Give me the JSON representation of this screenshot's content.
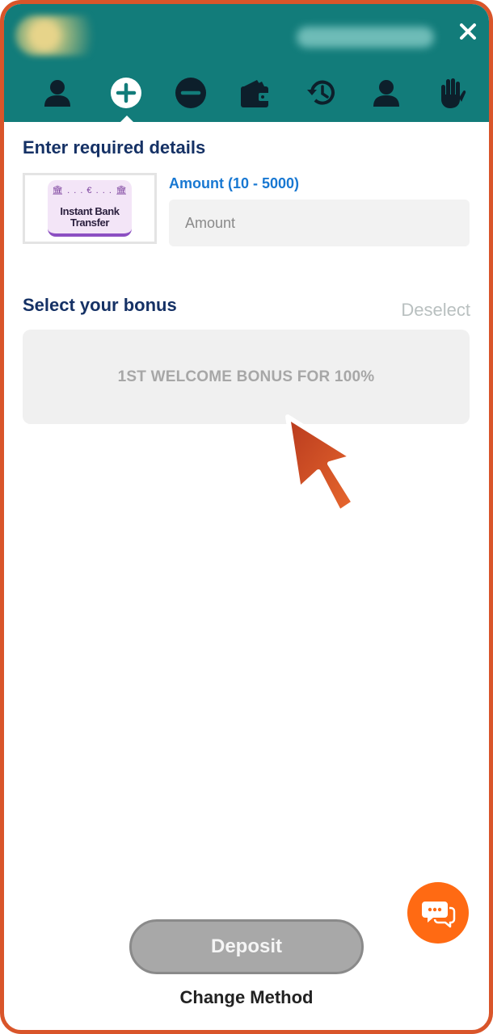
{
  "header": {
    "tabs": [
      {
        "icon": "user-icon",
        "active": false
      },
      {
        "icon": "plus-circle-icon",
        "active": true
      },
      {
        "icon": "minus-circle-icon",
        "active": false
      },
      {
        "icon": "wallet-icon",
        "active": false
      },
      {
        "icon": "history-icon",
        "active": false
      },
      {
        "icon": "profile-icon",
        "active": false
      },
      {
        "icon": "hand-icon",
        "active": false
      }
    ]
  },
  "form": {
    "title": "Enter required details",
    "method": {
      "glyphs": "🏛 . . . € . . . 🏛",
      "name_line1": "Instant Bank",
      "name_line2": "Transfer"
    },
    "amount_label": "Amount (10 - 5000)",
    "amount_placeholder": "Amount"
  },
  "bonus": {
    "title": "Select your bonus",
    "deselect_label": "Deselect",
    "option_label": "1ST WELCOME BONUS FOR 100%"
  },
  "footer": {
    "deposit_label": "Deposit",
    "change_method_label": "Change Method"
  },
  "colors": {
    "header_bg": "#127c7a",
    "frame_border": "#d9552a",
    "title": "#153165",
    "amount_label": "#1878d2",
    "chat_button": "#ff6a13",
    "deposit_disabled": "#a8a8a8"
  }
}
